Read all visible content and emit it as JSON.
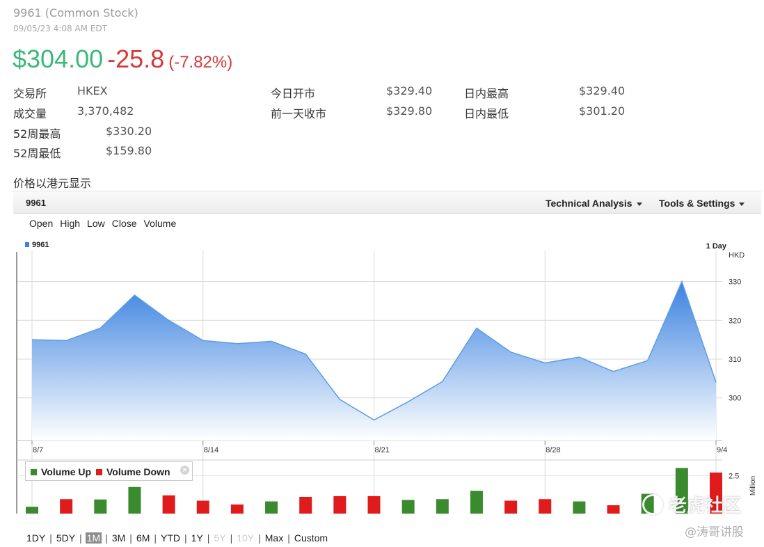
{
  "header": {
    "stock_name": "9961 (Common Stock)",
    "timestamp": "09/05/23 4:08 AM EDT",
    "price": "$304.00",
    "change": "-25.8",
    "change_pct": "(-7.82%)"
  },
  "stats": {
    "exchange_label": "交易所",
    "exchange_value": "HKEX",
    "volume_label": "成交量",
    "volume_value": "3,370,482",
    "wk52_high_label": "52周最高",
    "wk52_high_value": "$330.20",
    "wk52_low_label": "52周最低",
    "wk52_low_value": "$159.80",
    "open_label": "今日开市",
    "open_value": "$329.40",
    "prev_close_label": "前一天收市",
    "prev_close_value": "$329.80",
    "day_high_label": "日内最高",
    "day_high_value": "$329.40",
    "day_low_label": "日内最低",
    "day_low_value": "$301.20"
  },
  "currency_note": "价格以港元显示",
  "chart_header": {
    "symbol": "9961",
    "technical_analysis": "Technical Analysis",
    "tools_settings": "Tools & Settings"
  },
  "ohlc_menu": [
    "Open",
    "High",
    "Low",
    "Close",
    "Volume"
  ],
  "chart_data": {
    "type": "area",
    "series_name": "9961",
    "interval_label": "1 Day",
    "currency_label": "HKD",
    "volume_unit_label": "Million",
    "x_tick_labels": [
      "8/7",
      "8/14",
      "8/21",
      "8/28",
      "9/4"
    ],
    "x_tick_index": [
      0,
      5,
      10,
      15,
      20
    ],
    "price_ylim": [
      289,
      338
    ],
    "price_ticks": [
      300,
      310,
      320,
      330
    ],
    "price": [
      315,
      314.8,
      318,
      326.5,
      320,
      314.8,
      314,
      314.6,
      311.3,
      299.6,
      294.3,
      299,
      304.2,
      318,
      311.8,
      309,
      310.5,
      306.8,
      309.6,
      330,
      304
    ],
    "volume_ylim": [
      0,
      3.8
    ],
    "volume_ticks": [
      2.5
    ],
    "volume_tick_labels": [
      "2.5"
    ],
    "volume": [
      0.45,
      0.95,
      0.93,
      1.75,
      1.2,
      0.85,
      0.6,
      0.8,
      1.1,
      1.15,
      1.15,
      0.9,
      0.95,
      1.5,
      0.85,
      0.95,
      0.8,
      0.55,
      1.3,
      3.0,
      2.7
    ],
    "volume_direction": [
      "up",
      "down",
      "up",
      "up",
      "down",
      "down",
      "down",
      "up",
      "down",
      "down",
      "down",
      "up",
      "up",
      "up",
      "down",
      "down",
      "up",
      "down",
      "up",
      "up",
      "down"
    ],
    "legend": {
      "up": "Volume Up",
      "down": "Volume Down"
    },
    "colors": {
      "line": "#5a9de6",
      "fill_top": "#3b82e0",
      "fill_bottom": "#ffffff",
      "grid": "#d9d9d9",
      "volume_up": "#3a8a2e",
      "volume_down": "#e01b1b"
    }
  },
  "range_selector": [
    {
      "label": "1DY",
      "state": "normal"
    },
    {
      "label": "5DY",
      "state": "normal"
    },
    {
      "label": "1M",
      "state": "active"
    },
    {
      "label": "3M",
      "state": "normal"
    },
    {
      "label": "6M",
      "state": "normal"
    },
    {
      "label": "YTD",
      "state": "normal"
    },
    {
      "label": "1Y",
      "state": "normal"
    },
    {
      "label": "5Y",
      "state": "disabled"
    },
    {
      "label": "10Y",
      "state": "disabled"
    },
    {
      "label": "Max",
      "state": "normal"
    },
    {
      "label": "Custom",
      "state": "normal"
    }
  ],
  "watermark": {
    "logo_text": "老虎社区",
    "sub_text": "@涛哥讲股"
  }
}
